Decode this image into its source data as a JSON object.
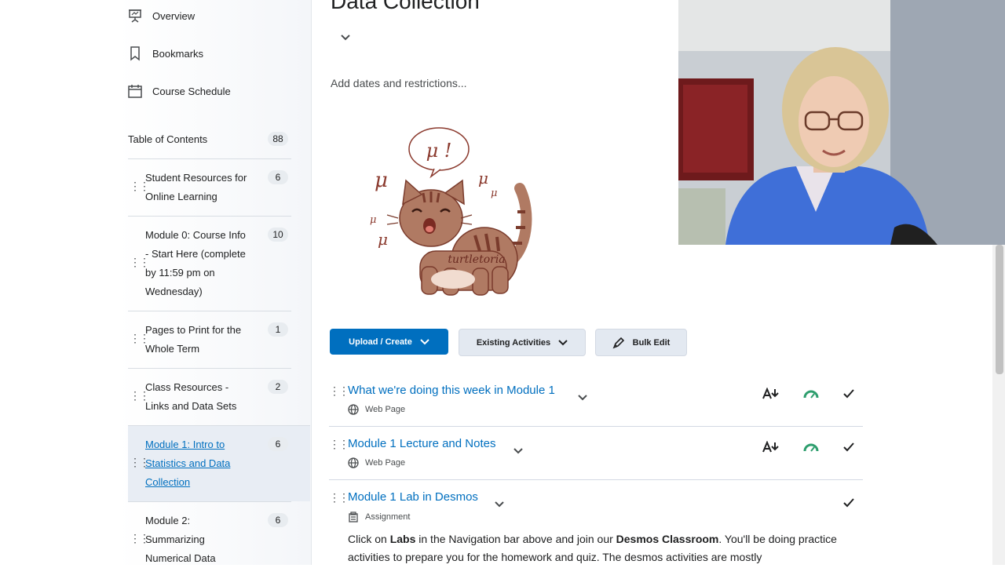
{
  "sidebar": {
    "nav": [
      {
        "label": "Overview",
        "icon": "presentation-icon"
      },
      {
        "label": "Bookmarks",
        "icon": "bookmark-icon"
      },
      {
        "label": "Course Schedule",
        "icon": "calendar-icon"
      }
    ],
    "toc_label": "Table of Contents",
    "toc_count": "88",
    "modules": [
      {
        "label": "Student Resources for Online Learning",
        "count": "6"
      },
      {
        "label": "Module 0: Course Info - Start Here (complete by 11:59 pm on Wednesday)",
        "count": "10"
      },
      {
        "label": "Pages to Print for the Whole Term",
        "count": "1"
      },
      {
        "label": "Class Resources - Links and Data Sets",
        "count": "2"
      },
      {
        "label": "Module 1: Intro to Statistics and Data Collection",
        "count": "6"
      },
      {
        "label": "Module 2: Summarizing Numerical Data",
        "count": "6"
      }
    ]
  },
  "main": {
    "title": "Data Collection",
    "add_dates": "Add dates and restrictions...",
    "image": {
      "speech": "μ !",
      "signature": "turtletoria",
      "marks": "μ"
    },
    "buttons": {
      "upload": "Upload / Create",
      "existing": "Existing Activities",
      "bulk": "Bulk Edit"
    },
    "items": [
      {
        "title": "What we're doing this week in Module 1",
        "type": "Web Page"
      },
      {
        "title": "Module 1 Lecture and Notes",
        "type": "Web Page"
      },
      {
        "title": "Module 1 Lab in Desmos",
        "type": "Assignment"
      }
    ],
    "desc": {
      "p1": "Click on ",
      "b1": "Labs",
      "p2": " in the Navigation bar above and join our ",
      "b2": "Desmos Classroom",
      "p3": ". You'll be doing practice activities to prepare you for the homework and quiz. The desmos activities are mostly"
    }
  },
  "colors": {
    "accent": "#006fbf",
    "completion_green": "#2e9e6e"
  }
}
